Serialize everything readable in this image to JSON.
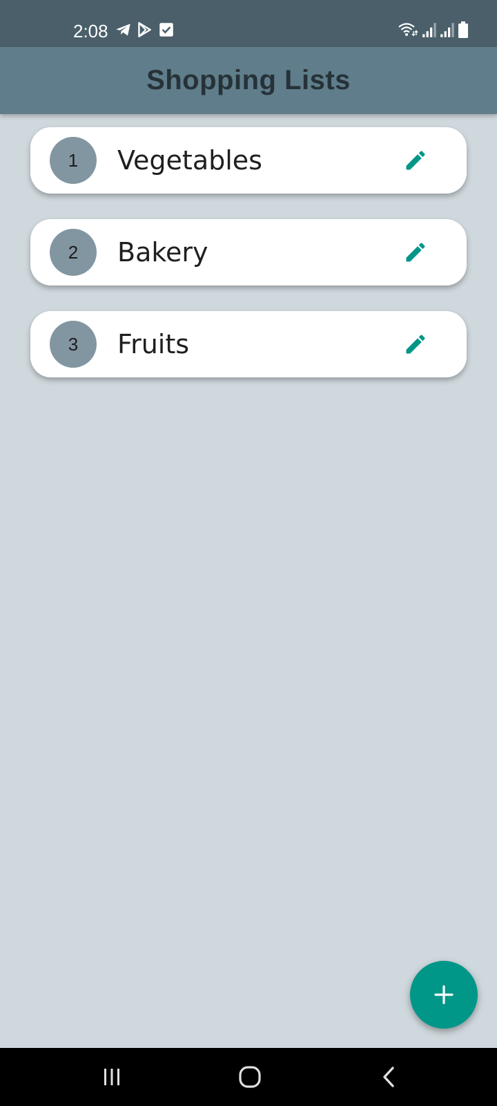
{
  "status_bar": {
    "time": "2:08",
    "left_icons": [
      "telegram-icon",
      "play-store-icon",
      "check-box-icon"
    ],
    "right_icons": [
      "wifi-icon",
      "signal-icon",
      "signal-icon",
      "battery-icon"
    ]
  },
  "app_bar": {
    "title": "Shopping Lists"
  },
  "lists": [
    {
      "number": "1",
      "name": "Vegetables"
    },
    {
      "number": "2",
      "name": "Bakery"
    },
    {
      "number": "3",
      "name": "Fruits"
    }
  ],
  "fab": {
    "icon": "plus-icon"
  },
  "nav_bar": {
    "icons": [
      "recent-apps-icon",
      "home-icon",
      "back-icon"
    ]
  },
  "colors": {
    "status_bar": "#4A5F6A",
    "app_bar": "#607D8B",
    "title_text": "#263238",
    "background": "#CFD8DD",
    "card": "#FFFFFF",
    "badge": "#8296A2",
    "accent": "#009688",
    "nav_bar": "#000000"
  }
}
